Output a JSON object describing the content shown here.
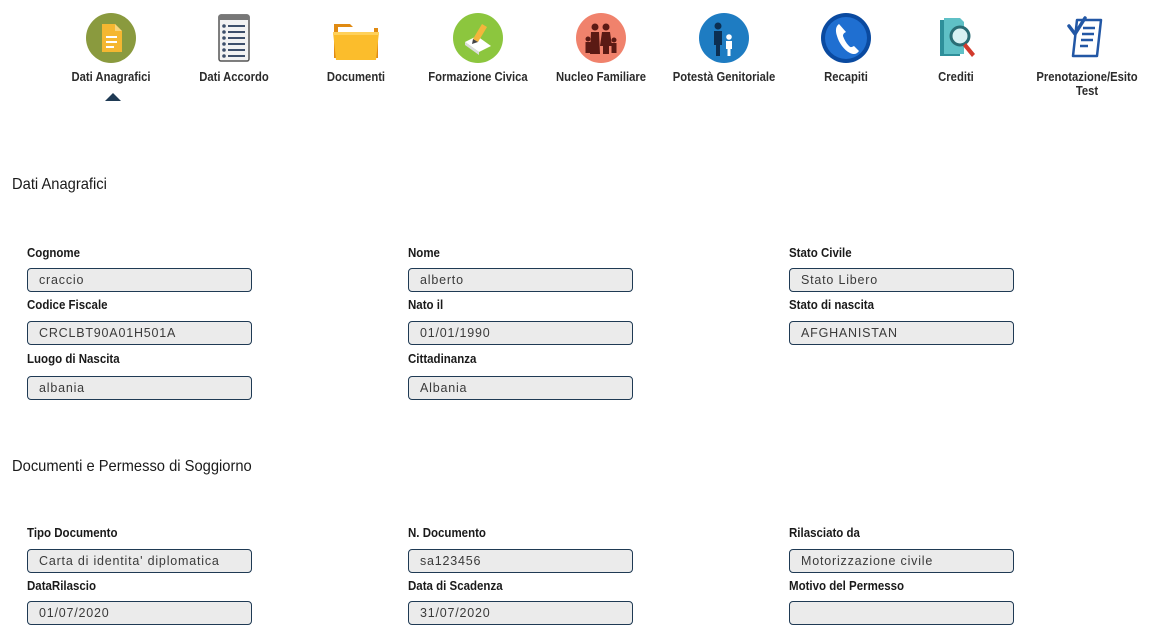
{
  "nav": [
    {
      "label": "Dati Anagrafici",
      "icon": "document-icon",
      "active": true
    },
    {
      "label": "Dati Accordo",
      "icon": "checklist-icon"
    },
    {
      "label": "Documenti",
      "icon": "folder-icon"
    },
    {
      "label": "Formazione Civica",
      "icon": "pencil-book-icon"
    },
    {
      "label": "Nucleo Familiare",
      "icon": "family-icon"
    },
    {
      "label": "Potestà Genitoriale",
      "icon": "parent-child-icon"
    },
    {
      "label": "Recapiti",
      "icon": "phone-icon"
    },
    {
      "label": "Crediti",
      "icon": "magnifier-document-icon"
    },
    {
      "label": "Prenotazione/Esito Test",
      "icon": "clipboard-check-icon"
    }
  ],
  "sections": {
    "anagrafici": {
      "title": "Dati Anagrafici",
      "fields": {
        "cognome": {
          "label": "Cognome",
          "value": "craccio"
        },
        "nome": {
          "label": "Nome",
          "value": "alberto"
        },
        "stato_civile": {
          "label": "Stato Civile",
          "value": "Stato Libero"
        },
        "codice_fiscale": {
          "label": "Codice Fiscale",
          "value": "CRCLBT90A01H501A"
        },
        "nato_il": {
          "label": "Nato il",
          "value": "01/01/1990"
        },
        "stato_nascita": {
          "label": "Stato di nascita",
          "value": "AFGHANISTAN"
        },
        "luogo_nascita": {
          "label": "Luogo di Nascita",
          "value": "albania"
        },
        "cittadinanza": {
          "label": "Cittadinanza",
          "value": "Albania"
        }
      }
    },
    "documenti": {
      "title": "Documenti e Permesso di Soggiorno",
      "fields": {
        "tipo_documento": {
          "label": "Tipo Documento",
          "value": "Carta di identita' diplomatica"
        },
        "n_documento": {
          "label": "N. Documento",
          "value": "sa123456"
        },
        "rilasciato_da": {
          "label": "Rilasciato da",
          "value": "Motorizzazione civile"
        },
        "data_rilascio": {
          "label": "DataRilascio",
          "value": "01/07/2020"
        },
        "data_scadenza": {
          "label": "Data di Scadenza",
          "value": "31/07/2020"
        },
        "motivo_permesso": {
          "label": "Motivo del Permesso",
          "value": ""
        }
      }
    }
  },
  "colors": {
    "active_caret": "#1f3a54",
    "input_border": "#1f3a54",
    "input_bg": "#ebebeb"
  }
}
